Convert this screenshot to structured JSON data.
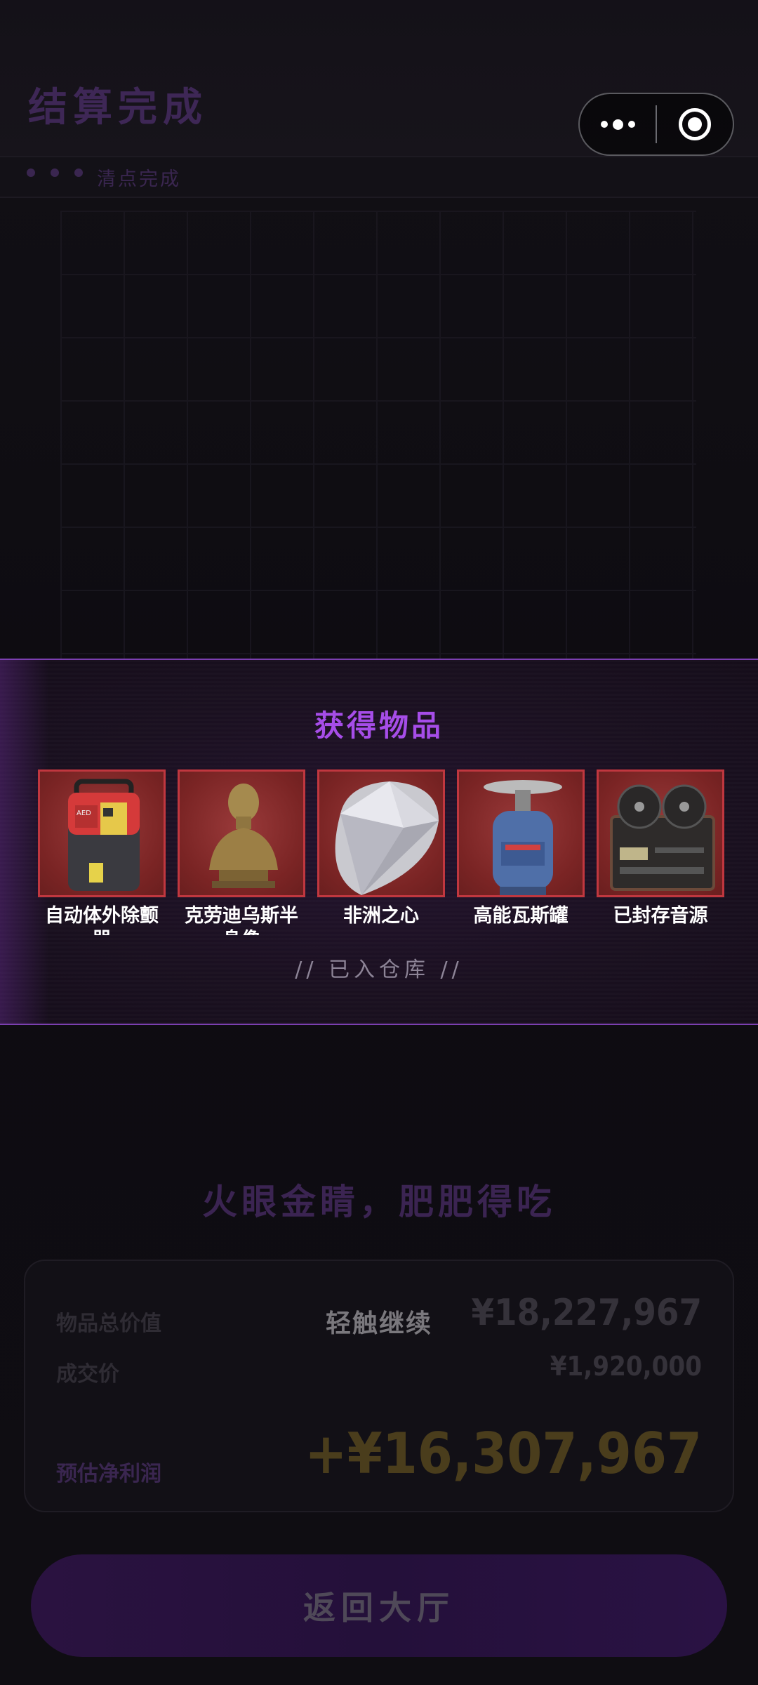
{
  "header": {
    "title": "结算完成",
    "status": "清点完成"
  },
  "panel": {
    "title": "获得物品",
    "items": [
      {
        "label": "自动体外除颤器",
        "icon": "aed-icon"
      },
      {
        "label": "克劳迪乌斯半身像",
        "icon": "bust-icon"
      },
      {
        "label": "非洲之心",
        "icon": "diamond-icon"
      },
      {
        "label": "高能瓦斯罐",
        "icon": "gas-canister-icon"
      },
      {
        "label": "已封存音源",
        "icon": "reel-recorder-icon"
      }
    ],
    "stored_text": "// 已入仓库 //"
  },
  "slogan": "火眼金睛，肥肥得吃",
  "summary": {
    "total_label": "物品总价值",
    "total_value": "¥18,227,967",
    "deal_label": "成交价",
    "deal_value": "¥1,920,000",
    "profit_label": "预估净利润",
    "profit_value": "+¥16,307,967"
  },
  "tap_hint": "轻触继续",
  "return_button": "返回大厅",
  "colors": {
    "accent": "#a64de8",
    "item_bg": "#7a2424",
    "item_border": "#c0373f"
  }
}
